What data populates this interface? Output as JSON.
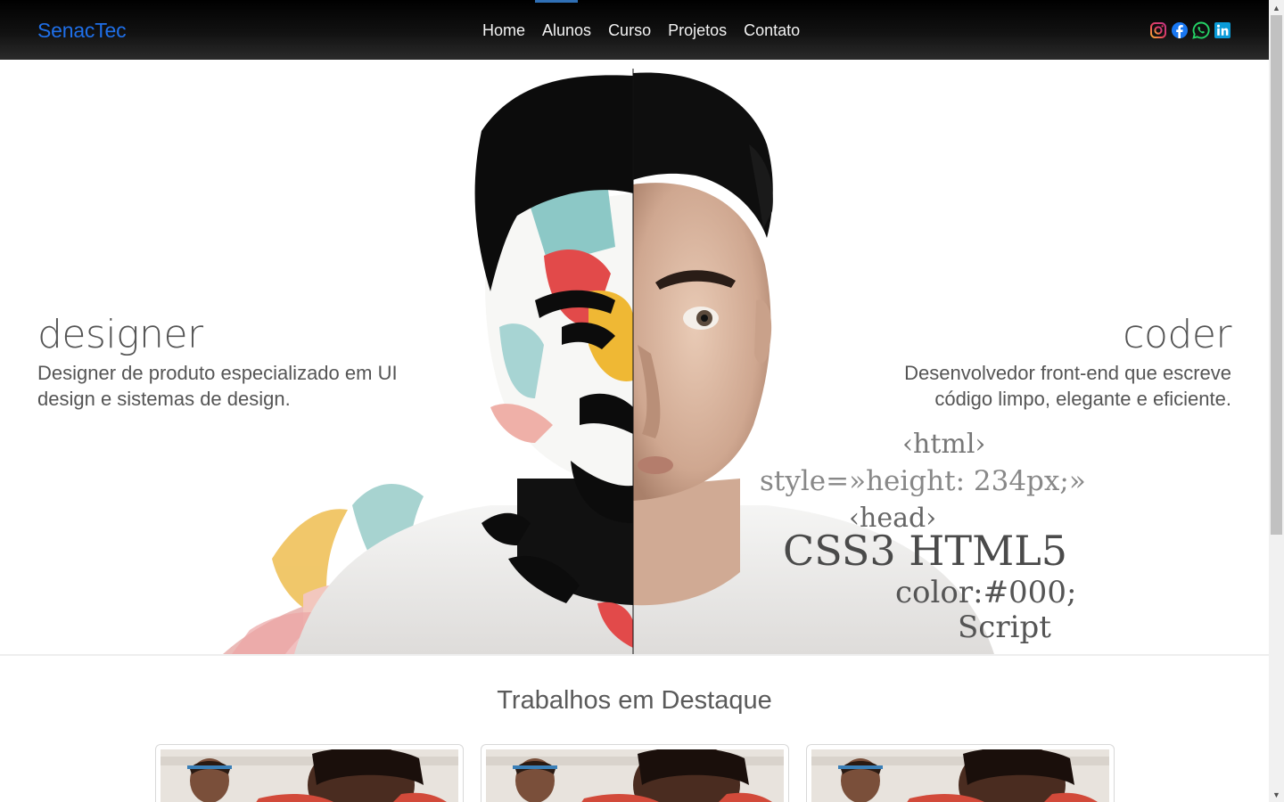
{
  "navbar": {
    "brand": "SenacTec",
    "links": [
      "Home",
      "Alunos",
      "Curso",
      "Projetos",
      "Contato"
    ],
    "socials": [
      "instagram-icon",
      "facebook-icon",
      "whatsapp-icon",
      "linkedin-icon"
    ],
    "brand_color": "#1f6fe8"
  },
  "hero": {
    "left": {
      "title": "designer",
      "description": "Designer de produto especializado em UI design e sistemas de design."
    },
    "right": {
      "title": "coder",
      "description": "Desenvolvedor front-end que escreve código limpo, elegante e eficiente."
    },
    "code_words": [
      "‹html›",
      "style=»height: 234px;»",
      "‹head›",
      "CSS3 HTML5",
      "color:#000;",
      "Script"
    ]
  },
  "featured": {
    "title": "Trabalhos em Destaque",
    "cards": [
      {},
      {},
      {}
    ]
  }
}
